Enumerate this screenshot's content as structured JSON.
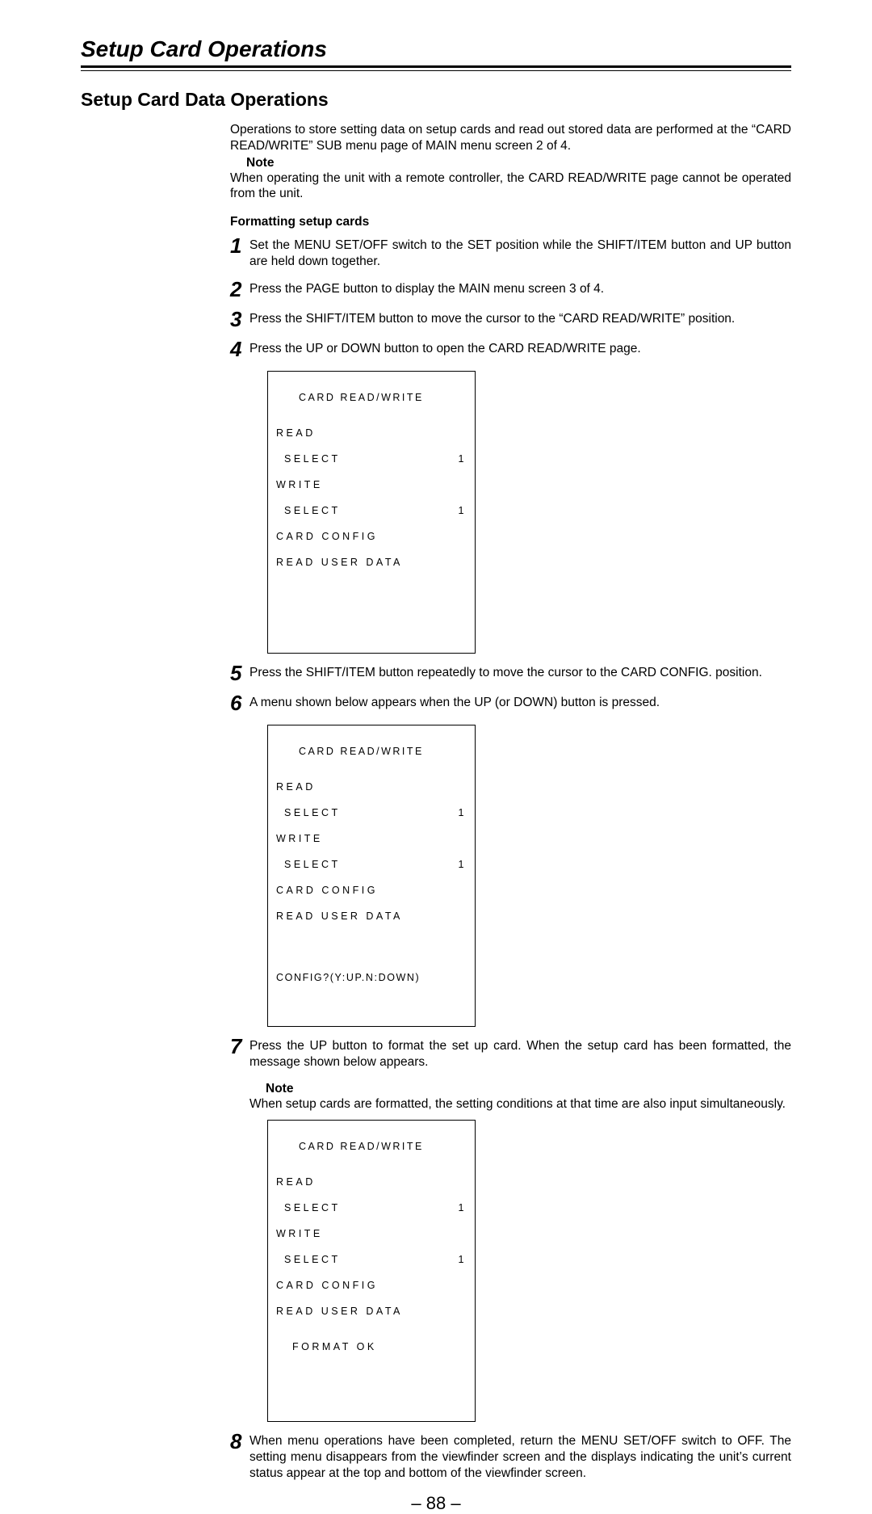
{
  "chapter_title": "Setup Card Operations",
  "section_title": "Setup Card Data Operations",
  "intro": "Operations to store setting data on setup cards and read out stored data are performed at the “CARD READ/WRITE” SUB menu page of MAIN menu screen 2 of 4.",
  "note_label": "Note",
  "intro_note": "When operating the unit with a remote controller, the CARD READ/WRITE page cannot be operated from the unit.",
  "sub_heading": "Formatting setup cards",
  "steps": {
    "s1": {
      "n": "1",
      "t": "Set the MENU SET/OFF switch to the SET position while the SHIFT/ITEM button and UP button are held down together."
    },
    "s2": {
      "n": "2",
      "t": "Press the PAGE button to display the MAIN menu screen 3 of 4."
    },
    "s3": {
      "n": "3",
      "t": "Press the SHIFT/ITEM button to move the cursor to the “CARD READ/WRITE” position."
    },
    "s4": {
      "n": "4",
      "t": "Press the UP or DOWN button to open the CARD READ/WRITE page."
    },
    "s5": {
      "n": "5",
      "t": "Press the SHIFT/ITEM button repeatedly to move the cursor to the CARD CONFIG. position."
    },
    "s6": {
      "n": "6",
      "t": "A menu shown below appears when the UP (or DOWN) button is pressed."
    },
    "s7": {
      "n": "7",
      "t": "Press the UP button to format the set up card. When the setup card has been formatted, the message shown below appears."
    },
    "s7_note": "When setup cards are formatted, the setting conditions at that time are also input simultaneously.",
    "s8": {
      "n": "8",
      "t": "When menu operations have been completed, return the MENU SET/OFF switch to OFF. The setting menu disappears from the viewfinder screen and the displays indicating the unit’s current status appear at the top and bottom of the viewfinder screen."
    }
  },
  "screen": {
    "title": "CARD READ/WRITE",
    "read": "READ",
    "select": "SELECT",
    "one": "1",
    "write": "WRITE",
    "card_config": "CARD CONFIG",
    "read_user": "READ USER DATA",
    "config_prompt": "CONFIG?(Y:UP.N:DOWN)",
    "format_ok": "FORMAT OK"
  },
  "page_number": "– 88 –"
}
